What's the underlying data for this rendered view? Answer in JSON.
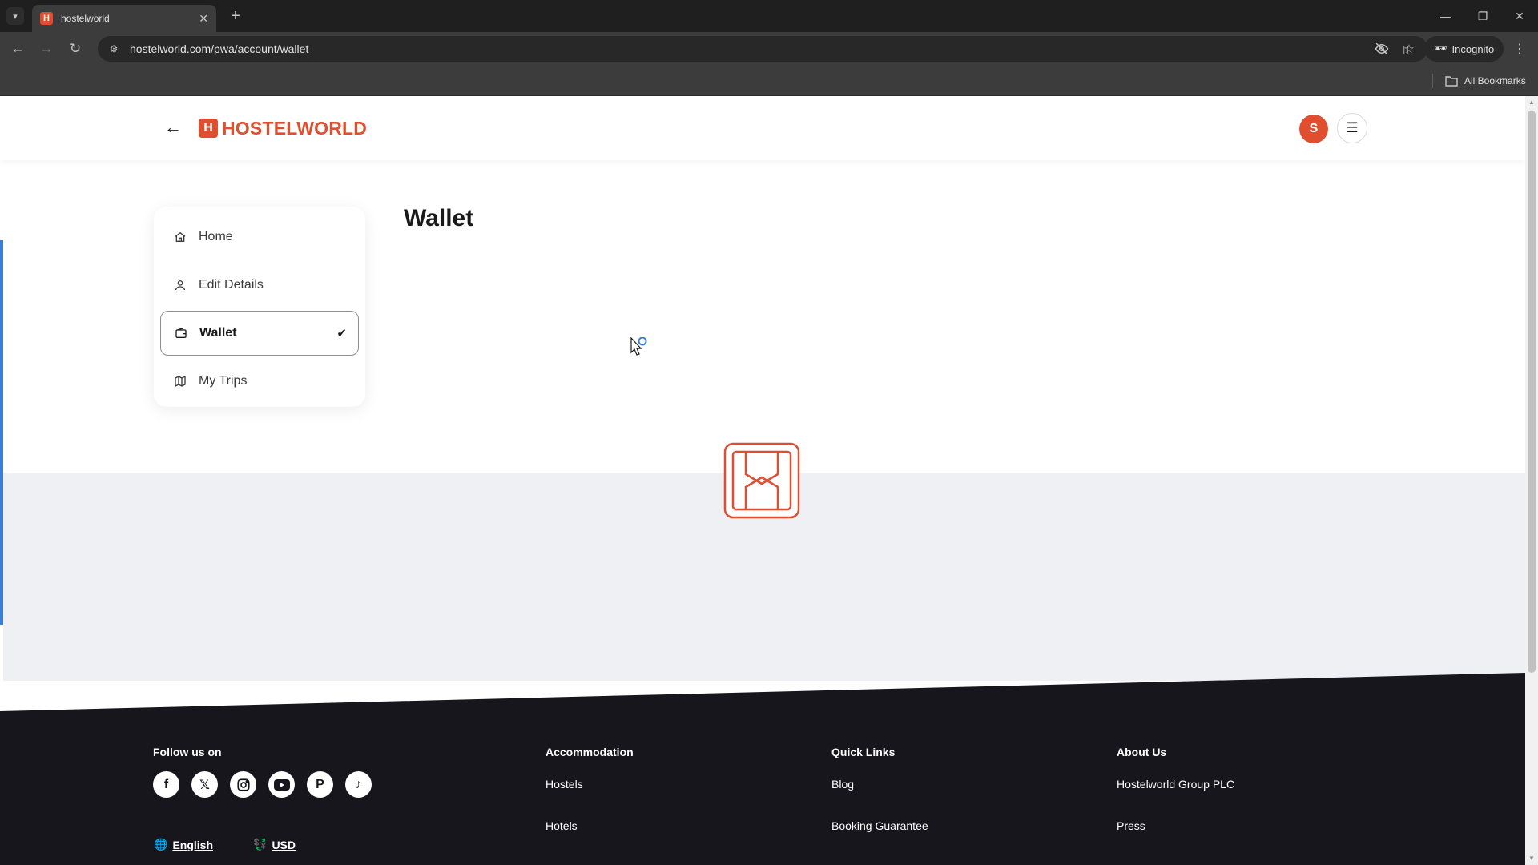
{
  "browser": {
    "tab_title": "hostelworld",
    "tab_favicon_letter": "H",
    "url": "hostelworld.com/pwa/account/wallet",
    "incognito_label": "Incognito",
    "all_bookmarks_label": "All Bookmarks"
  },
  "header": {
    "logo_text": "HOSTELWORLD",
    "logo_mark": "H",
    "avatar_initial": "S"
  },
  "account_nav": {
    "items": [
      {
        "label": "Home",
        "icon": "home-icon",
        "active": false
      },
      {
        "label": "Edit Details",
        "icon": "user-icon",
        "active": false
      },
      {
        "label": "Wallet",
        "icon": "wallet-icon",
        "active": true
      },
      {
        "label": "My Trips",
        "icon": "map-icon",
        "active": false
      }
    ]
  },
  "main": {
    "title": "Wallet"
  },
  "footer": {
    "follow_heading": "Follow us on",
    "socials": [
      "facebook-icon",
      "x-icon",
      "instagram-icon",
      "youtube-icon",
      "pinterest-icon",
      "tiktok-icon"
    ],
    "language": "English",
    "currency": "USD",
    "accommodation": {
      "heading": "Accommodation",
      "links": [
        "Hostels",
        "Hotels"
      ]
    },
    "quick_links": {
      "heading": "Quick Links",
      "links": [
        "Blog",
        "Booking Guarantee"
      ]
    },
    "about": {
      "heading": "About Us",
      "links": [
        "Hostelworld Group PLC",
        "Press"
      ]
    }
  },
  "colors": {
    "brand": "#e04e2f",
    "footer_bg": "#16161c",
    "band_bg": "#eff0f3",
    "accent_bar": "#3b7dd8"
  }
}
